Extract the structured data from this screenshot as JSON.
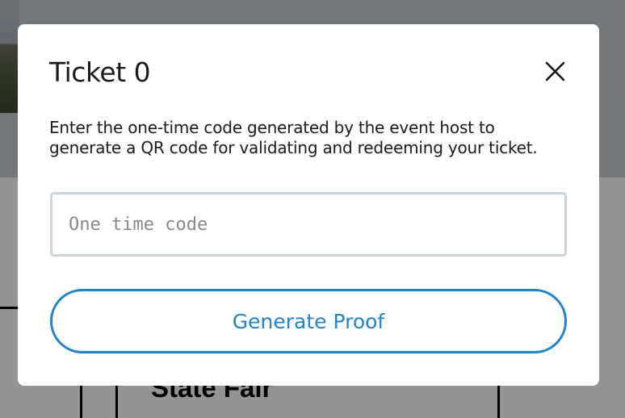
{
  "background": {
    "card_title": "State Fair"
  },
  "modal": {
    "title": "Ticket 0",
    "close_icon": "close-icon",
    "description": "Enter the one-time code generated by the event host to generate a QR code for validating and redeeming your ticket.",
    "code_input": {
      "value": "",
      "placeholder": "One time code"
    },
    "generate_button_label": "Generate Proof"
  },
  "colors": {
    "accent": "#1b85d6",
    "input_border": "#c8d3dc",
    "overlay": "rgba(0,0,0,0.42)"
  }
}
